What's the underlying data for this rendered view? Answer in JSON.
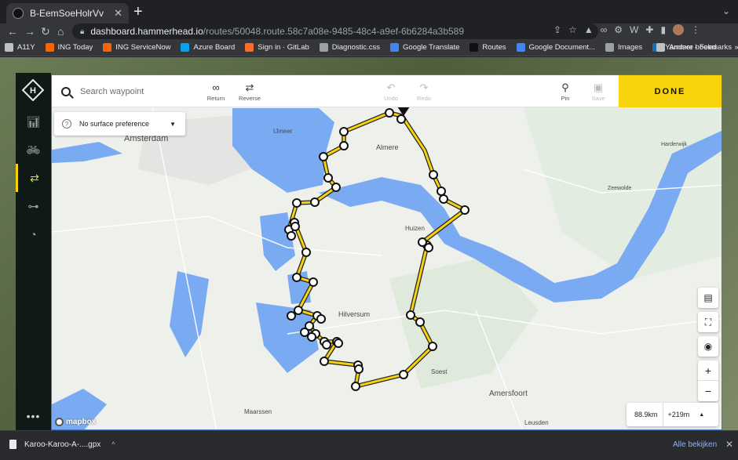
{
  "browser": {
    "tab_title": "B-EemSoeHolrVv",
    "tab_close": "✕",
    "new_tab": "+",
    "url_host": "dashboard.hammerhead.io",
    "url_path": "/routes/50048.route.58c7a08e-9485-48c4-a9ef-6b6284a3b589",
    "bookmarks": [
      {
        "label": "A11Y",
        "icon": "folder-icon",
        "color": "#bdc1c6"
      },
      {
        "label": "ING Today",
        "icon": "ing-icon",
        "color": "#ff6200"
      },
      {
        "label": "ING ServiceNow",
        "icon": "ing-icon",
        "color": "#ff6200"
      },
      {
        "label": "Azure Board",
        "icon": "microsoft-icon",
        "color": "#00a4ef"
      },
      {
        "label": "Sign in · GitLab",
        "icon": "gitlab-icon",
        "color": "#fc6d26"
      },
      {
        "label": "Diagnostic.css",
        "icon": "globe-icon",
        "color": "#9aa0a6"
      },
      {
        "label": "Google Translate",
        "icon": "translate-icon",
        "color": "#4285f4"
      },
      {
        "label": "Routes",
        "icon": "hammerhead-icon",
        "color": "#111111"
      },
      {
        "label": "Google Document...",
        "icon": "doc-icon",
        "color": "#4285f4"
      },
      {
        "label": "Images",
        "icon": "globe-icon",
        "color": "#9aa0a6"
      },
      {
        "label": "Yammer - Feed",
        "icon": "yammer-icon",
        "color": "#106ebe"
      }
    ],
    "bookmarks_overflow": "»",
    "other_bookmarks": "Andere bookmarks"
  },
  "app": {
    "search_placeholder": "Search waypoint",
    "toolbar": {
      "return_label": "Return",
      "reverse_label": "Reverse",
      "undo_label": "Undo",
      "redo_label": "Redo",
      "pin_label": "Pin",
      "save_label": "Save",
      "done_label": "DONE"
    },
    "surface_preference": "No surface preference",
    "surface_help": "?",
    "distance": "88.9km",
    "elevation": "+219m",
    "attribution": "mapbox",
    "sidebar_more": "•••",
    "accent_color": "#f6d30b"
  },
  "map": {
    "places": [
      {
        "name": "Amsterdam",
        "kind": "city"
      },
      {
        "name": "IJmeer",
        "kind": "water"
      },
      {
        "name": "Almere",
        "kind": "city"
      },
      {
        "name": "Huizen",
        "kind": "town"
      },
      {
        "name": "Hilversum",
        "kind": "city"
      },
      {
        "name": "Soest",
        "kind": "town"
      },
      {
        "name": "Amersfoort",
        "kind": "city"
      },
      {
        "name": "Maarssen",
        "kind": "town"
      },
      {
        "name": "Leusden",
        "kind": "town"
      },
      {
        "name": "Harderwijk",
        "kind": "town"
      },
      {
        "name": "Zeewolde",
        "kind": "town"
      }
    ],
    "route_color": "#f6d30b",
    "water_color": "#7aaaf2",
    "waypoint_count": 43
  },
  "downloads": {
    "file_name": "Karoo-Karoo-A-....gpx",
    "show_all": "Alle bekijken",
    "close": "✕"
  }
}
